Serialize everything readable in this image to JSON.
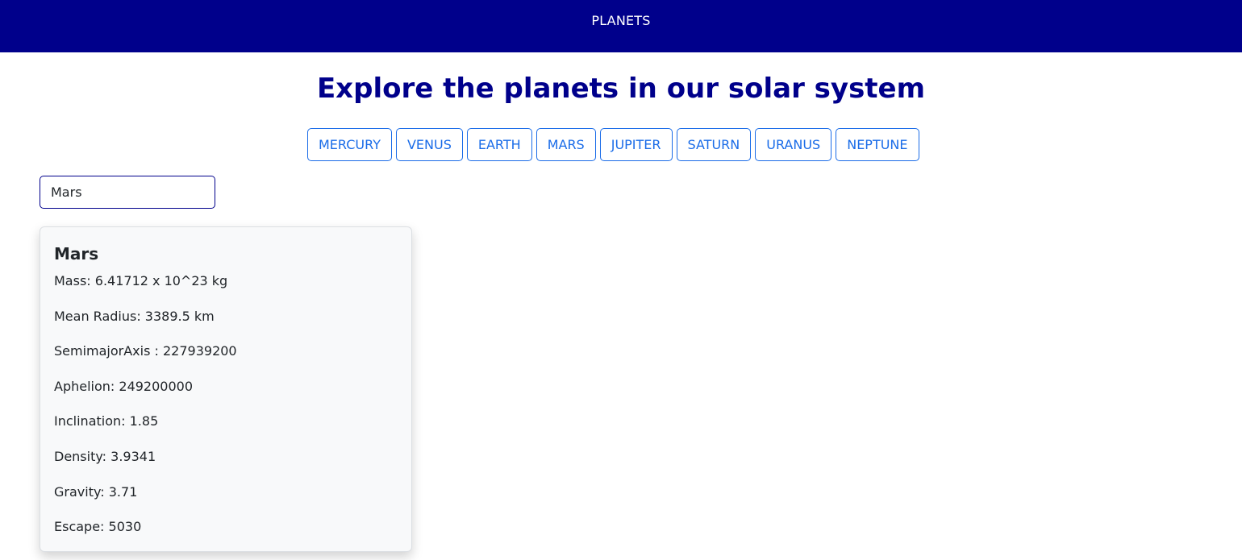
{
  "navbar": {
    "title": "PLANETS",
    "bg_color": "#00008b"
  },
  "heading": "Explore the planets in our solar system",
  "planet_buttons": [
    {
      "label": "MERCURY"
    },
    {
      "label": "VENUS"
    },
    {
      "label": "EARTH"
    },
    {
      "label": "MARS"
    },
    {
      "label": "JUPITER"
    },
    {
      "label": "SATURN"
    },
    {
      "label": "URANUS"
    },
    {
      "label": "NEPTUNE"
    }
  ],
  "search": {
    "value": "Mars",
    "placeholder": ""
  },
  "card": {
    "title": "Mars",
    "rows": [
      "Mass: 6.41712 x 10^23 kg",
      "Mean Radius: 3389.5 km",
      "SemimajorAxis : 227939200",
      "Aphelion: 249200000",
      "Inclination: 1.85",
      "Density: 3.9341",
      "Gravity: 3.71",
      "Escape: 5030"
    ]
  },
  "colors": {
    "accent": "#1a6ce8",
    "heading": "#00008b"
  }
}
